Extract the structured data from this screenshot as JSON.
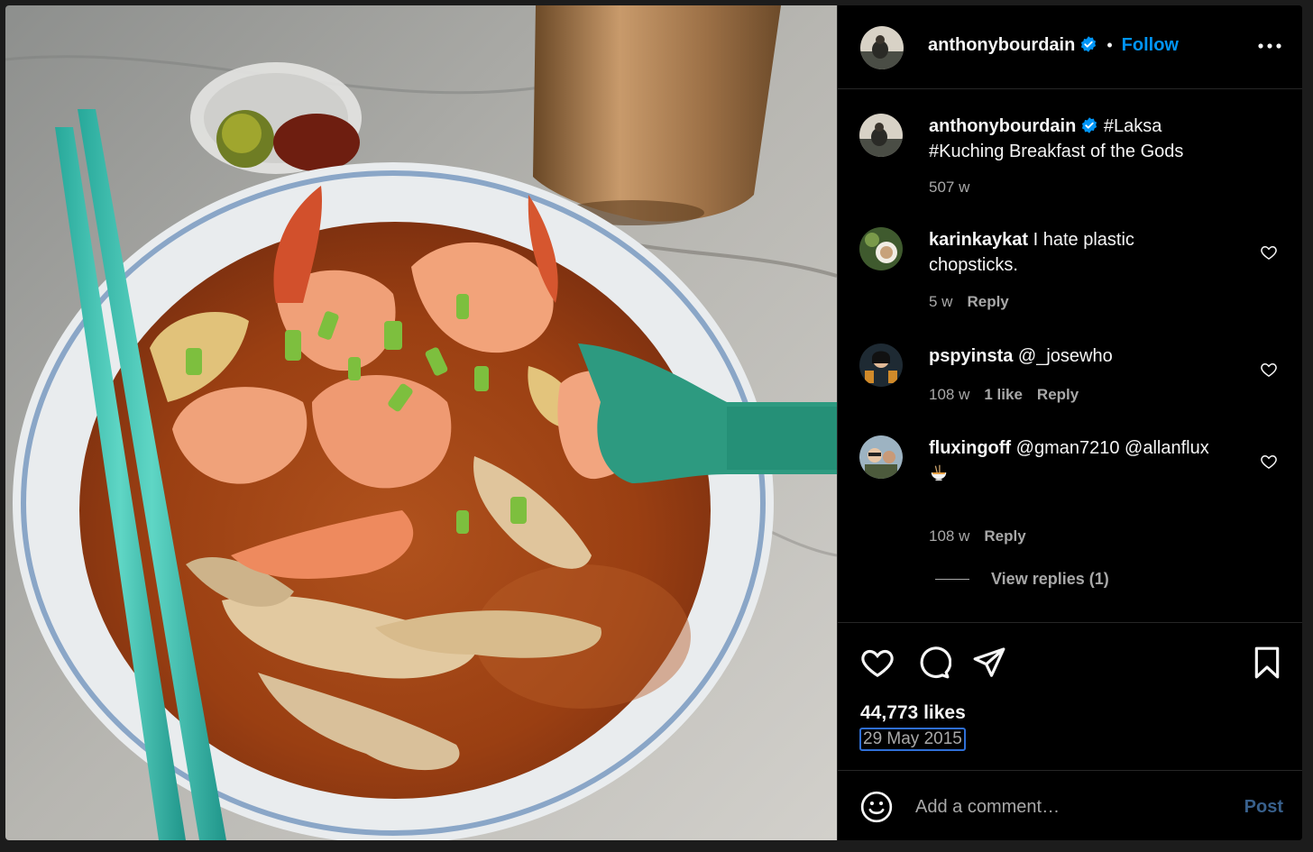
{
  "post": {
    "author": "anthonybourdain",
    "follow_label": "Follow",
    "separator": "•",
    "caption": "#Laksa #Kuching Breakfast of the Gods",
    "caption_time": "507 w"
  },
  "comments": [
    {
      "user": "karinkaykat",
      "text": "I hate plastic chopsticks.",
      "time": "5 w",
      "reply_label": "Reply"
    },
    {
      "user": "pspyinsta",
      "text": "@_josewho",
      "time": "108 w",
      "likes": "1 like",
      "reply_label": "Reply"
    },
    {
      "user": "fluxingoff",
      "text": "@gman7210 @allanflux",
      "emoji": "noodle-bowl-icon",
      "time": "108 w",
      "reply_label": "Reply",
      "view_replies": "View replies (1)"
    }
  ],
  "actions": {
    "likes": "44,773 likes",
    "date": "29 May 2015"
  },
  "add_comment": {
    "placeholder": "Add a comment…",
    "post_label": "Post"
  },
  "icons": [
    "verified-badge-icon",
    "more-options-icon",
    "heart-icon",
    "comment-icon",
    "share-icon",
    "bookmark-icon",
    "emoji-smile-icon"
  ],
  "colors": {
    "background": "#000000",
    "text": "#f5f5f5",
    "secondary": "#a8a8a8",
    "follow": "#0095f6",
    "post_disabled": "#38608c",
    "date_outline": "#2f6fd6"
  }
}
